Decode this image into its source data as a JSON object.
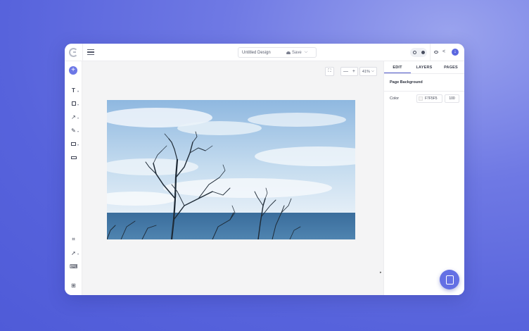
{
  "header": {
    "design_title": "Untitled Design",
    "save_label": "Save",
    "save_chevron": "⌵"
  },
  "canvas": {
    "zoom_minus": "—",
    "zoom_plus": "+",
    "zoom_level": "41%",
    "zoom_chevron": "⌵",
    "fit_icon": "⛶",
    "collapse_arrow": "▸"
  },
  "toolbar": {
    "add": "+",
    "text_tool": "T",
    "arrow_tool": "↗",
    "pen_tool": "✎",
    "crop_tool": "⌗",
    "select_tool": "➚",
    "keyboard_tool": "⌨",
    "resize_tool": "⊞"
  },
  "panel": {
    "tabs": [
      {
        "label": "EDIT"
      },
      {
        "label": "LAYERS"
      },
      {
        "label": "PAGES"
      }
    ],
    "section_title": "Page Background",
    "color_label": "Color",
    "color_value": "F7F5F5",
    "opacity_value": "100"
  },
  "colors": {
    "accent": "#5b67e0",
    "canvas_bg": "#f4f4f5",
    "sky": "#a9c8e6",
    "sea": "#3f6f9a"
  }
}
